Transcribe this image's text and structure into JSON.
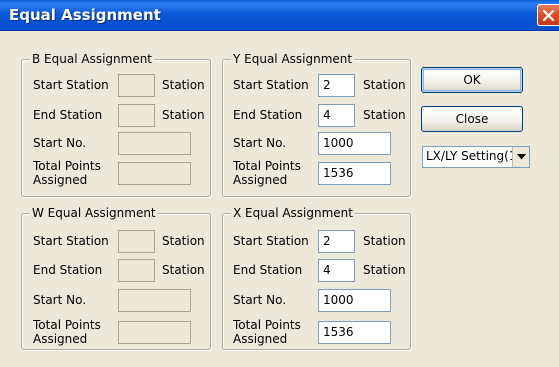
{
  "window": {
    "title": "Equal Assignment"
  },
  "labels": {
    "start_station": "Start Station",
    "end_station": "End Station",
    "station_unit": "Station",
    "start_no": "Start No.",
    "total_points_line1": "Total Points",
    "total_points_line2": "Assigned"
  },
  "groups": {
    "b": {
      "title": "B Equal Assignment",
      "start_station": "",
      "end_station": "",
      "start_no": "",
      "total_points": ""
    },
    "y": {
      "title": "Y Equal Assignment",
      "start_station": "2",
      "end_station": "4",
      "start_no": "1000",
      "total_points": "1536"
    },
    "w": {
      "title": "W Equal Assignment",
      "start_station": "",
      "end_station": "",
      "start_no": "",
      "total_points": ""
    },
    "x": {
      "title": "X Equal Assignment",
      "start_station": "2",
      "end_station": "4",
      "start_no": "1000",
      "total_points": "1536"
    }
  },
  "buttons": {
    "ok": "OK",
    "close": "Close"
  },
  "setting_select": {
    "selected": "LX/LY Setting(1)"
  },
  "icons": {
    "close": "close-icon",
    "dropdown": "chevron-down-icon"
  }
}
